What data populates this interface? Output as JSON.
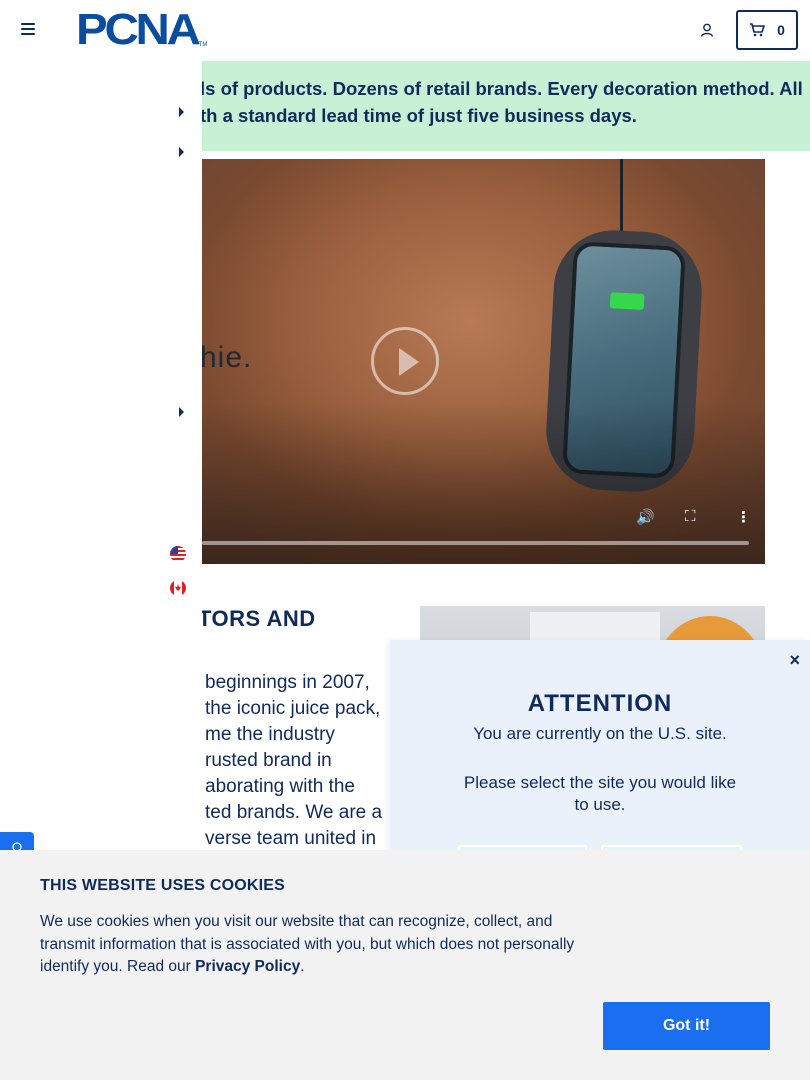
{
  "header": {
    "logo_text": "PCNA",
    "logo_tm": "TM",
    "cart_count": "0"
  },
  "banner": {
    "line1": "ls of products. Dozens of retail brands. Every decoration method. All",
    "line2": "th a standard lead time of just five business days."
  },
  "video": {
    "brand_text": "hie."
  },
  "section": {
    "heading": "TORS AND",
    "body_lines": [
      "beginnings in 2007,",
      "the iconic juice pack,",
      "me the industry",
      "rusted brand in",
      "aborating with the",
      "ted brands. We are a",
      "verse team united in"
    ]
  },
  "modal": {
    "close": "×",
    "title": "ATTENTION",
    "subtitle": "You are currently on the U.S. site.",
    "prompt": "Please select the site you would like to use."
  },
  "cookie": {
    "title": "THIS WEBSITE USES COOKIES",
    "text_before": "We use cookies when you visit our website that can recognize, collect, and transmit information that is associated with you, but which does not personally identify you. Read our ",
    "link": "Privacy Policy",
    "text_after": ".",
    "button": "Got it!"
  },
  "icons": [
    "menu-icon",
    "account-icon",
    "cart-icon",
    "play-icon",
    "volume-icon",
    "fullscreen-icon",
    "more-icon",
    "us-flag-icon",
    "canada-flag-icon",
    "chat-icon"
  ],
  "colors": {
    "brand_blue": "#0a4d9e",
    "navy": "#0f2a5c",
    "banner_green": "#c8f0d4",
    "modal_bg": "#eaf1fb",
    "cta_blue": "#1a6ef0"
  }
}
